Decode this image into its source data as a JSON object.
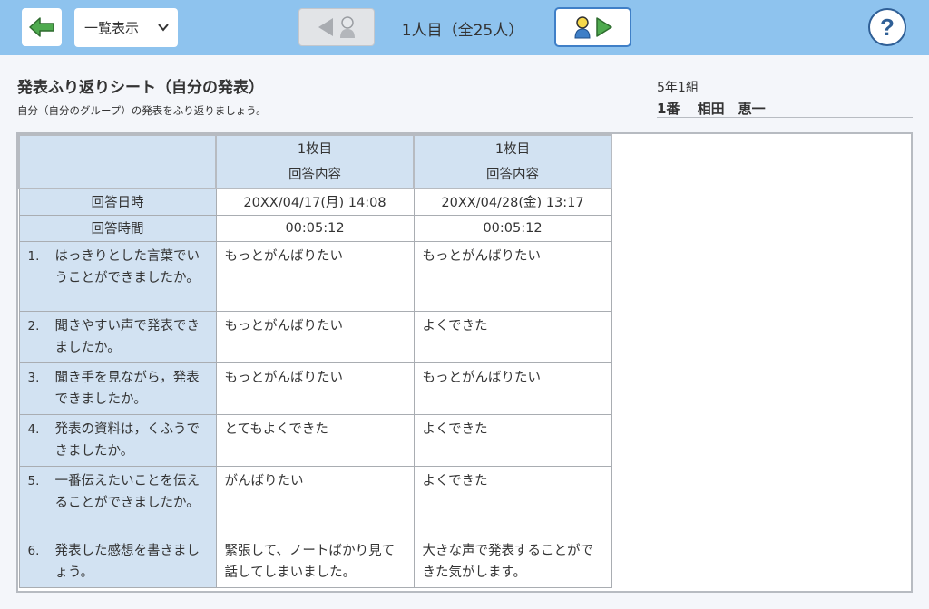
{
  "toolbar": {
    "view_mode": "一覧表示",
    "student_counter": "1人目（全25人）"
  },
  "colors": {
    "topbar": "#8ec3ee",
    "accent": "#3f7fc7",
    "back_arrow": "#3c8f3c"
  },
  "sheet": {
    "title": "発表ふり返りシート（自分の発表）",
    "description": "自分（自分のグループ）の発表をふり返りましょう。",
    "class_label": "5年1組",
    "student_number": "1番",
    "student_name": "相田　恵一"
  },
  "table": {
    "columns": [
      {
        "sheet": "1枚目",
        "label": "回答内容"
      },
      {
        "sheet": "1枚目",
        "label": "回答内容"
      }
    ],
    "answer_datetime_label": "回答日時",
    "answer_duration_label": "回答時間",
    "answer_datetimes": [
      "20XX/04/17(月) 14:08",
      "20XX/04/28(金) 13:17"
    ],
    "answer_durations": [
      "00:05:12",
      "00:05:12"
    ],
    "questions": [
      {
        "num": "1.",
        "text": "はっきりとした言葉でいうことができましたか。",
        "answers": [
          "もっとがんばりたい",
          "もっとがんばりたい"
        ]
      },
      {
        "num": "2.",
        "text": "聞きやすい声で発表できましたか。",
        "answers": [
          "もっとがんばりたい",
          "よくできた"
        ]
      },
      {
        "num": "3.",
        "text": "聞き手を見ながら，発表できましたか。",
        "answers": [
          "もっとがんばりたい",
          "もっとがんばりたい"
        ]
      },
      {
        "num": "4.",
        "text": "発表の資料は，くふうできましたか。",
        "answers": [
          "とてもよくできた",
          "よくできた"
        ]
      },
      {
        "num": "5.",
        "text": "一番伝えたいことを伝えることができましたか。",
        "answers": [
          "がんばりたい",
          "よくできた"
        ]
      },
      {
        "num": "6.",
        "text": "発表した感想を書きましょう。",
        "answers": [
          "緊張して、ノートばかり見て話してしまいました。",
          "大きな声で発表することができた気がします。"
        ]
      }
    ]
  }
}
